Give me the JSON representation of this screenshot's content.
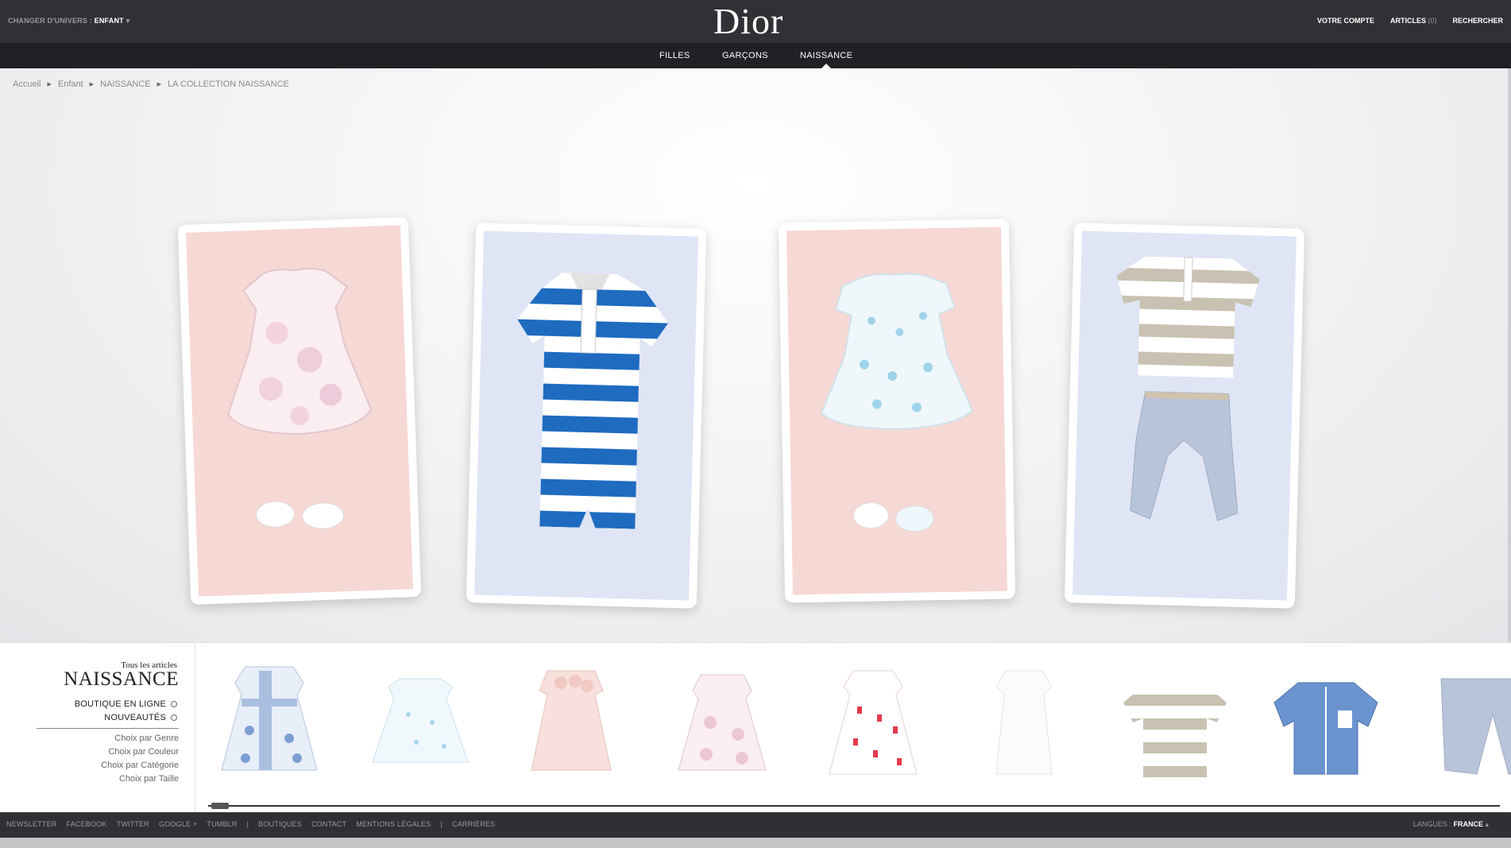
{
  "header": {
    "univers_label": "CHANGER D'UNIVERS :",
    "univers_value": "ENFANT",
    "logo": "Dior",
    "account": "VOTRE COMPTE",
    "articles": "ARTICLES",
    "articles_count": "(0)",
    "search": "RECHERCHER"
  },
  "nav": {
    "items": [
      "FILLES",
      "GARÇONS",
      "NAISSANCE"
    ],
    "active": "NAISSANCE"
  },
  "breadcrumb": [
    "Accueil",
    "Enfant",
    "NAISSANCE",
    "LA COLLECTION NAISSANCE"
  ],
  "hero_cards": [
    {
      "name": "pink-dress-card",
      "bg": "#f6d8d4"
    },
    {
      "name": "striped-romper-card",
      "bg": "#dfe5f5"
    },
    {
      "name": "polka-dress-card",
      "bg": "#f6d8d4"
    },
    {
      "name": "polo-outfit-card",
      "bg": "#dfe5f5"
    }
  ],
  "sidebar": {
    "tous": "Tous les articles",
    "title": "NAISSANCE",
    "boutique": "BOUTIQUE EN LIGNE",
    "nouveautes": "NOUVEAUTÉS",
    "choices": [
      "Choix par Genre",
      "Choix par Couleur",
      "Choix par Catégorie",
      "Choix par Taille"
    ]
  },
  "footer": {
    "links": [
      "NEWSLETTER",
      "FACEBOOK",
      "TWITTER",
      "GOOGLE +",
      "TUMBLR",
      "|",
      "BOUTIQUES",
      "CONTACT",
      "MENTIONS LÉGALES",
      "|",
      "CARRIÈRES"
    ],
    "lang_label": "LANGUES :",
    "lang_value": "FRANCE"
  },
  "colors": {
    "header_bg": "#303135",
    "nav_bg": "#202124",
    "pink_panel": "#f6d8d4",
    "blue_panel": "#dfe5f5",
    "stripe_blue": "#1e6bc0"
  }
}
